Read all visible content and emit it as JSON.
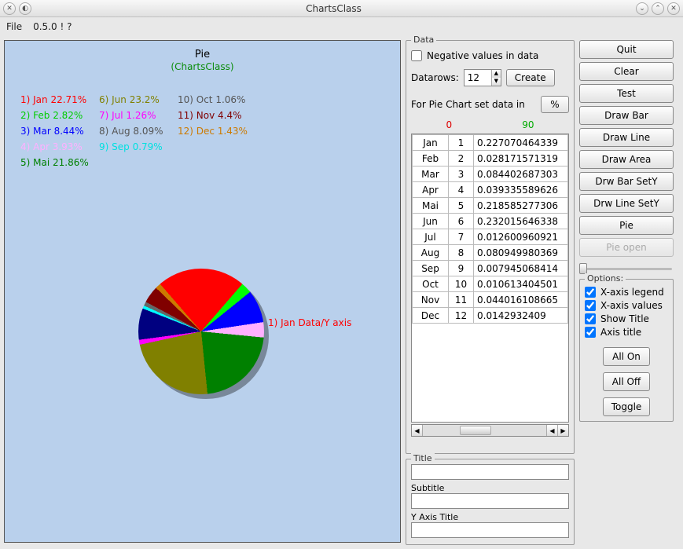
{
  "window": {
    "title": "ChartsClass"
  },
  "menubar": {
    "file": "File",
    "version": "0.5.0 ! ?"
  },
  "chart": {
    "title": "Pie",
    "subtitle": "(ChartsClass)",
    "slice_label": "1) Jan Data/Y axis"
  },
  "chart_data": {
    "type": "pie",
    "title": "Pie",
    "subtitle": "(ChartsClass)",
    "categories": [
      "Jan",
      "Feb",
      "Mar",
      "Apr",
      "Mai",
      "Jun",
      "Jul",
      "Aug",
      "Sep",
      "Oct",
      "Nov",
      "Dec"
    ],
    "percent": [
      22.71,
      2.82,
      8.44,
      3.93,
      21.86,
      23.2,
      1.26,
      8.09,
      0.79,
      1.06,
      4.4,
      1.43
    ],
    "colors": [
      "#ff0000",
      "#00ff00",
      "#0000ff",
      "#ffb0ff",
      "#008000",
      "#808000",
      "#ff00ff",
      "#000080",
      "#00ffff",
      "#666666",
      "#800000",
      "#cc7a00"
    ],
    "legend": [
      {
        "text": "1) Jan 22.71%",
        "color": "#ff0000"
      },
      {
        "text": "2) Feb 2.82%",
        "color": "#00cc00"
      },
      {
        "text": "3) Mar 8.44%",
        "color": "#0000ff"
      },
      {
        "text": "4) Apr 3.93%",
        "color": "#ffb0ff"
      },
      {
        "text": "5) Mai 21.86%",
        "color": "#008000"
      },
      {
        "text": "6) Jun 23.2%",
        "color": "#808000"
      },
      {
        "text": "7) Jul 1.26%",
        "color": "#ff00ff"
      },
      {
        "text": "8) Aug 8.09%",
        "color": "#555555"
      },
      {
        "text": "9) Sep 0.79%",
        "color": "#00e0e0"
      },
      {
        "text": "10) Oct 1.06%",
        "color": "#555555"
      },
      {
        "text": "11) Nov 4.4%",
        "color": "#800000"
      },
      {
        "text": "12) Dec 1.43%",
        "color": "#cc7a00"
      }
    ]
  },
  "data_panel": {
    "legend": "Data",
    "negative": "Negative values in data",
    "datarows_label": "Datarows:",
    "datarows_value": "12",
    "create": "Create",
    "pie_line": "For Pie Chart set data in",
    "pct": "%",
    "header0": "0",
    "header1": "90",
    "rows": [
      {
        "a": "Jan",
        "b": "1",
        "c": "0.227070464339"
      },
      {
        "a": "Feb",
        "b": "2",
        "c": "0.028171571319"
      },
      {
        "a": "Mar",
        "b": "3",
        "c": "0.084402687303"
      },
      {
        "a": "Apr",
        "b": "4",
        "c": "0.039335589626"
      },
      {
        "a": "Mai",
        "b": "5",
        "c": "0.218585277306"
      },
      {
        "a": "Jun",
        "b": "6",
        "c": "0.232015646338"
      },
      {
        "a": "Jul",
        "b": "7",
        "c": "0.012600960921"
      },
      {
        "a": "Aug",
        "b": "8",
        "c": "0.080949980369"
      },
      {
        "a": "Sep",
        "b": "9",
        "c": "0.007945068414"
      },
      {
        "a": "Oct",
        "b": "10",
        "c": "0.010613404501"
      },
      {
        "a": "Nov",
        "b": "11",
        "c": "0.044016108665"
      },
      {
        "a": "Dec",
        "b": "12",
        "c": "0.0142932409"
      }
    ]
  },
  "title_panel": {
    "legend": "Title",
    "title_val": "",
    "subtitle_lbl": "Subtitle",
    "subtitle_val": "",
    "yaxis_lbl": "Y Axis Title",
    "yaxis_val": ""
  },
  "buttons": {
    "quit": "Quit",
    "clear": "Clear",
    "test": "Test",
    "draw_bar": "Draw Bar",
    "draw_line": "Draw Line",
    "draw_area": "Draw Area",
    "drw_bar_sety": "Drw Bar SetY",
    "drw_line_sety": "Drw Line SetY",
    "pie": "Pie",
    "pie_open": "Pie open"
  },
  "options": {
    "legend": "Options:",
    "x_legend": "X-axis legend",
    "x_values": "X-axis values",
    "show_title": "Show Title",
    "axis_title": "Axis title",
    "all_on": "All On",
    "all_off": "All Off",
    "toggle": "Toggle"
  }
}
